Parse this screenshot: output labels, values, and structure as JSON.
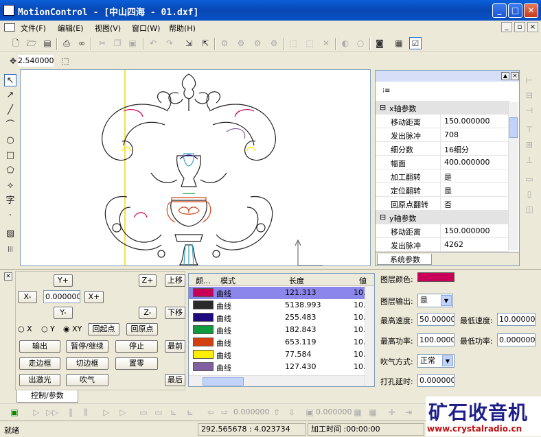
{
  "window": {
    "title": "MotionControl - [中山四海 - 01.dxf]",
    "minimize": "_",
    "maximize": "□",
    "close": "✕"
  },
  "menu": {
    "items": [
      "文件(F)",
      "编辑(E)",
      "视图(V)",
      "窗口(W)",
      "帮助(H)"
    ],
    "mdi_min": "_",
    "mdi_restore": "▫",
    "mdi_close": "×"
  },
  "toolbar2": {
    "step_value": "2.540000"
  },
  "properties": {
    "groups": [
      {
        "name": "x轴参数",
        "rows": [
          [
            "移动距离",
            "150.000000"
          ],
          [
            "发出脉冲",
            "708"
          ],
          [
            "细分数",
            "16细分"
          ],
          [
            "幅面",
            "400.000000"
          ],
          [
            "加工翻转",
            "是"
          ],
          [
            "定位翻转",
            "是"
          ],
          [
            "回原点翻转",
            "否"
          ]
        ]
      },
      {
        "name": "y轴参数",
        "rows": [
          [
            "移动距离",
            "150.000000"
          ],
          [
            "发出脉冲",
            "4262"
          ]
        ]
      }
    ],
    "tab": "系统参数"
  },
  "control": {
    "y_plus": "Y+",
    "y_minus": "Y-",
    "x_minus": "X-",
    "x_plus": "X+",
    "step": "0.000000",
    "z_plus": "Z+",
    "z_minus": "Z-",
    "up": "上移",
    "down": "下移",
    "radio": [
      "X",
      "Y",
      "XY"
    ],
    "radio_selected": "XY",
    "back_origin_start": "回起点",
    "back_origin": "回原点",
    "output": "输出",
    "pause": "暂停/继续",
    "stop": "停止",
    "first": "最前",
    "walk_frame": "走边框",
    "cut_frame": "切边框",
    "set_zero": "置零",
    "laser": "出激光",
    "blow": "吹气",
    "last": "最后",
    "tab": "控制/参数"
  },
  "layers": {
    "headers": [
      "颜...",
      "模式",
      "长度",
      "値"
    ],
    "rows": [
      {
        "color": "#c8005a",
        "mode": "曲线",
        "length": "121.313",
        "v": "10.",
        "selected": true
      },
      {
        "color": "#2a2a2a",
        "mode": "曲线",
        "length": "5138.993",
        "v": "10."
      },
      {
        "color": "#1e0a80",
        "mode": "曲线",
        "length": "255.483",
        "v": "10."
      },
      {
        "color": "#109a40",
        "mode": "曲线",
        "length": "182.843",
        "v": "10."
      },
      {
        "color": "#d04010",
        "mode": "曲线",
        "length": "653.119",
        "v": "10."
      },
      {
        "color": "#ffee00",
        "mode": "曲线",
        "length": "77.584",
        "v": "10."
      },
      {
        "color": "#8060a0",
        "mode": "曲线",
        "length": "127.430",
        "v": "10."
      }
    ]
  },
  "layerprops": {
    "color_label": "图层颜色:",
    "color": "#c8005a",
    "output_label": "图层输出:",
    "output": "是",
    "max_speed_label": "最高速度:",
    "max_speed": "50.000000",
    "min_speed_label": "最低速度:",
    "min_speed": "10.000000",
    "max_power_label": "最高功率:",
    "max_power": "100.000000",
    "min_power_label": "最低功率:",
    "min_power": "0.000000",
    "blow_label": "吹气方式:",
    "blow": "正常",
    "punch_label": "打孔延时:",
    "punch": "0.000000"
  },
  "bottomtb": {
    "value1": "0.000000",
    "value2": "0.000000"
  },
  "status": {
    "ready": "就绪",
    "coords": "292.565678 : 4.023734",
    "time": "加工时间 :00:00:00"
  },
  "watermark": {
    "title": "矿石收音机",
    "url": "www.crystalradio.cn"
  }
}
